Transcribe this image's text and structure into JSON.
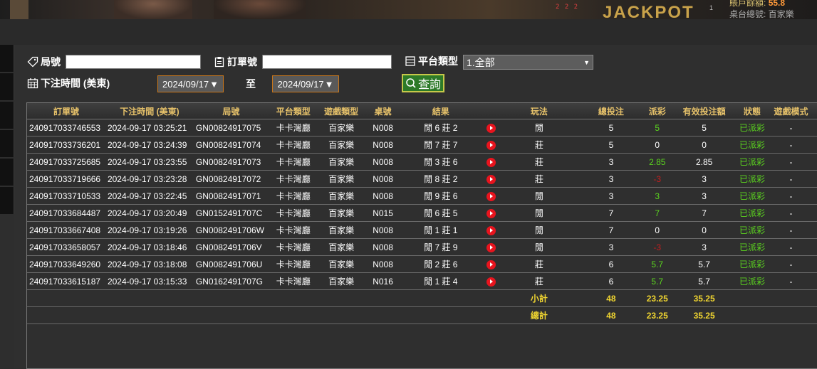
{
  "banner": {
    "slot_text": "2 2 2",
    "jackpot": "JACKPOT",
    "nums": "1",
    "account_label": "賬戶餘額:",
    "account_value": "55.8",
    "platform_text": "桌台總號: 百家樂"
  },
  "filters": {
    "round_label": "局號",
    "round_value": "",
    "order_label": "訂單號",
    "order_value": "",
    "platform_label": "平台類型",
    "platform_selected": "1.全部",
    "bet_time_label": "下注時間 (美東)",
    "date_from": "2024/09/17",
    "to_label": "至",
    "date_to": "2024/09/17",
    "query_label": "查詢"
  },
  "table": {
    "headers": [
      "訂單號",
      "下注時間 (美東)",
      "局號",
      "平台類型",
      "遊戲類型",
      "桌號",
      "結果",
      "",
      "玩法",
      "總投注",
      "派彩",
      "有效投注額",
      "狀態",
      "遊戲模式"
    ],
    "rows": [
      {
        "order": "240917033746553",
        "time": "2024-09-17 03:25:21",
        "round": "GN00824917075",
        "platform": "卡卡灣廳",
        "game": "百家樂",
        "table": "N008",
        "result": "閒 6 莊 2",
        "play": "閒",
        "bet": "5",
        "payout": "5",
        "payout_color": "green",
        "valid": "5",
        "status": "已派彩",
        "mode": "-"
      },
      {
        "order": "240917033736201",
        "time": "2024-09-17 03:24:39",
        "round": "GN00824917074",
        "platform": "卡卡灣廳",
        "game": "百家樂",
        "table": "N008",
        "result": "閒 7 莊 7",
        "play": "莊",
        "bet": "5",
        "payout": "0",
        "payout_color": "white",
        "valid": "0",
        "status": "已派彩",
        "mode": "-"
      },
      {
        "order": "240917033725685",
        "time": "2024-09-17 03:23:55",
        "round": "GN00824917073",
        "platform": "卡卡灣廳",
        "game": "百家樂",
        "table": "N008",
        "result": "閒 3 莊 6",
        "play": "莊",
        "bet": "3",
        "payout": "2.85",
        "payout_color": "green",
        "valid": "2.85",
        "status": "已派彩",
        "mode": "-"
      },
      {
        "order": "240917033719666",
        "time": "2024-09-17 03:23:28",
        "round": "GN00824917072",
        "platform": "卡卡灣廳",
        "game": "百家樂",
        "table": "N008",
        "result": "閒 8 莊 2",
        "play": "莊",
        "bet": "3",
        "payout": "-3",
        "payout_color": "red",
        "valid": "3",
        "status": "已派彩",
        "mode": "-"
      },
      {
        "order": "240917033710533",
        "time": "2024-09-17 03:22:45",
        "round": "GN00824917071",
        "platform": "卡卡灣廳",
        "game": "百家樂",
        "table": "N008",
        "result": "閒 9 莊 6",
        "play": "閒",
        "bet": "3",
        "payout": "3",
        "payout_color": "green",
        "valid": "3",
        "status": "已派彩",
        "mode": "-"
      },
      {
        "order": "240917033684487",
        "time": "2024-09-17 03:20:49",
        "round": "GN0152491707C",
        "platform": "卡卡灣廳",
        "game": "百家樂",
        "table": "N015",
        "result": "閒 6 莊 5",
        "play": "閒",
        "bet": "7",
        "payout": "7",
        "payout_color": "green",
        "valid": "7",
        "status": "已派彩",
        "mode": "-"
      },
      {
        "order": "240917033667408",
        "time": "2024-09-17 03:19:26",
        "round": "GN0082491706W",
        "platform": "卡卡灣廳",
        "game": "百家樂",
        "table": "N008",
        "result": "閒 1 莊 1",
        "play": "閒",
        "bet": "7",
        "payout": "0",
        "payout_color": "white",
        "valid": "0",
        "status": "已派彩",
        "mode": "-"
      },
      {
        "order": "240917033658057",
        "time": "2024-09-17 03:18:46",
        "round": "GN0082491706V",
        "platform": "卡卡灣廳",
        "game": "百家樂",
        "table": "N008",
        "result": "閒 7 莊 9",
        "play": "閒",
        "bet": "3",
        "payout": "-3",
        "payout_color": "red",
        "valid": "3",
        "status": "已派彩",
        "mode": "-"
      },
      {
        "order": "240917033649260",
        "time": "2024-09-17 03:18:08",
        "round": "GN0082491706U",
        "platform": "卡卡灣廳",
        "game": "百家樂",
        "table": "N008",
        "result": "閒 2 莊 6",
        "play": "莊",
        "bet": "6",
        "payout": "5.7",
        "payout_color": "green",
        "valid": "5.7",
        "status": "已派彩",
        "mode": "-"
      },
      {
        "order": "240917033615187",
        "time": "2024-09-17 03:15:33",
        "round": "GN0162491707G",
        "platform": "卡卡灣廳",
        "game": "百家樂",
        "table": "N016",
        "result": "閒 1 莊 4",
        "play": "莊",
        "bet": "6",
        "payout": "5.7",
        "payout_color": "green",
        "valid": "5.7",
        "status": "已派彩",
        "mode": "-"
      }
    ],
    "subtotal": {
      "label": "小計",
      "bet": "48",
      "payout": "23.25",
      "valid": "35.25"
    },
    "total": {
      "label": "總計",
      "bet": "48",
      "payout": "23.25",
      "valid": "35.25"
    }
  },
  "colors": {
    "header_text": "#e7c26a",
    "win": "#5bd41f",
    "loss": "#c81e1e",
    "summary": "#f0d530",
    "query_button": "#2d7a28"
  },
  "icons": {
    "round": "tag-icon",
    "order": "clipboard-icon",
    "platform": "list-icon",
    "time": "calendar-icon",
    "query": "search-icon",
    "result": "play-icon"
  }
}
